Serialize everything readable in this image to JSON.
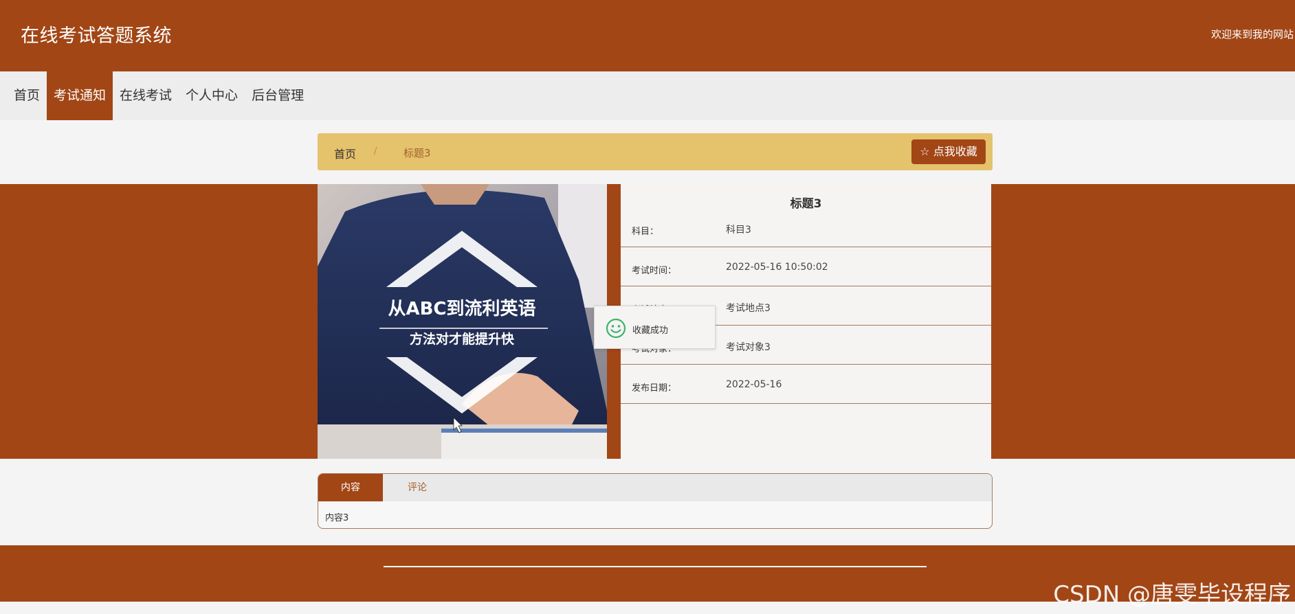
{
  "header": {
    "site_title": "在线考试答题系统",
    "welcome": "欢迎来到我的网站"
  },
  "nav": {
    "items": [
      {
        "label": "首页"
      },
      {
        "label": "考试通知",
        "active": true
      },
      {
        "label": "在线考试"
      },
      {
        "label": "个人中心"
      },
      {
        "label": "后台管理"
      }
    ]
  },
  "breadcrumb": {
    "home": "首页",
    "separator": "/",
    "current": "标题3",
    "favorite_button": "☆ 点我收藏"
  },
  "photo": {
    "line1": "从ABC到流利英语",
    "line2": "方法对才能提升快"
  },
  "details": {
    "title": "标题3",
    "rows": [
      {
        "label": "科目：",
        "value": "科目3"
      },
      {
        "label": "考试时间：",
        "value": "2022-05-16 10:50:02"
      },
      {
        "label": "考试地点：",
        "value": "考试地点3"
      },
      {
        "label": "考试对象：",
        "value": "考试对象3"
      },
      {
        "label": "发布日期：",
        "value": "2022-05-16"
      }
    ]
  },
  "toast": {
    "icon": "smiley-face-icon",
    "text": "收藏成功"
  },
  "tabs": {
    "items": [
      {
        "label": "内容",
        "active": true
      },
      {
        "label": "评论"
      }
    ],
    "content": "内容3"
  },
  "watermark": "CSDN @唐雯毕设程序",
  "colors": {
    "brand": "#a24616",
    "breadcrumb_bg": "#e5c26c",
    "nav_bg": "#ededed"
  }
}
